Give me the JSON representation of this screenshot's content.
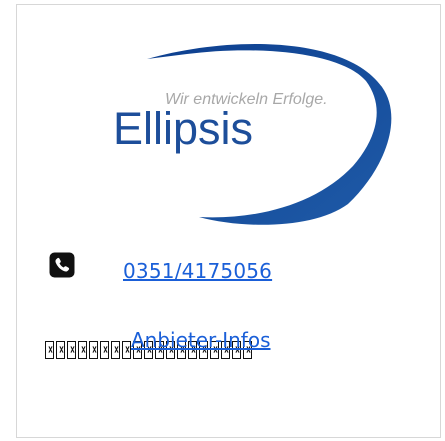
{
  "brand": {
    "name": "Ellipsis",
    "tagline": "Wir entwickeln Erfolge.",
    "colors": {
      "primary": "#1d4e9a",
      "secondary": "#1a5fd8",
      "text": "#111111"
    }
  },
  "contact": {
    "phone_icon": "phone-icon",
    "phone_number": "0351/4175056"
  },
  "provider": {
    "label": "Anbieter-Infos"
  }
}
